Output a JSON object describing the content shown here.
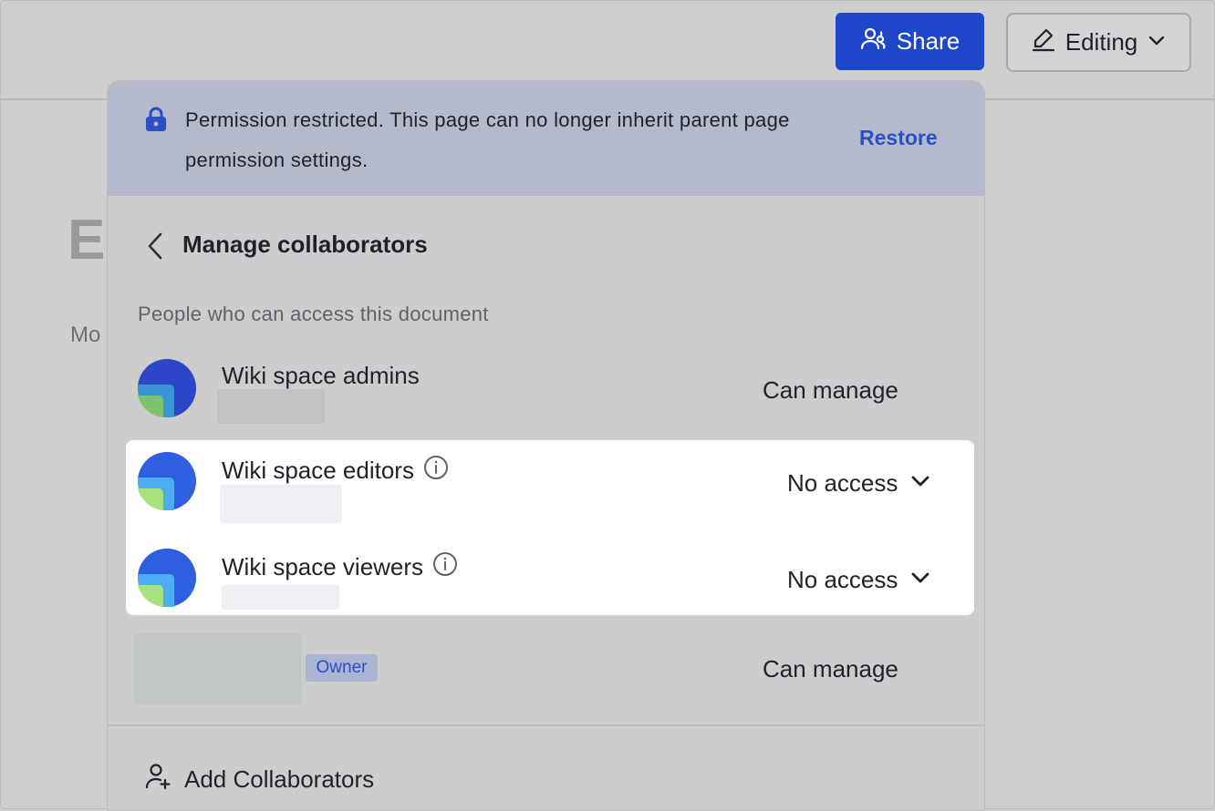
{
  "background": {
    "heading_letter": "E",
    "text_fragment": "Mo"
  },
  "header": {
    "share_label": "Share",
    "editing_label": "Editing"
  },
  "banner": {
    "message": "Permission restricted. This page can no longer inherit parent page permission settings.",
    "restore_label": "Restore"
  },
  "panel": {
    "title": "Manage collaborators",
    "section_label": "People who can access this document"
  },
  "collaborators": [
    {
      "name": "Wiki space admins",
      "permission": "Can manage"
    },
    {
      "name": "Wiki space editors",
      "permission": "No access"
    },
    {
      "name": "Wiki space viewers",
      "permission": "No access"
    },
    {
      "name": "",
      "badge": "Owner",
      "permission": "Can manage"
    }
  ],
  "footer": {
    "add_label": "Add Collaborators"
  },
  "colors": {
    "accent": "#1d46c9",
    "link": "#2a4fc4",
    "banner_bg": "#b4bacb"
  }
}
